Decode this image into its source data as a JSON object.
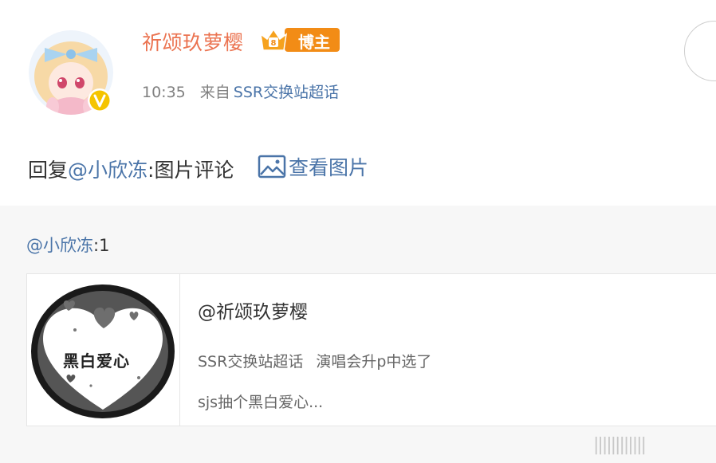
{
  "post": {
    "username": "祈颂玖萝樱",
    "badge_label": "博主",
    "time": "10:35",
    "from_label": "来自",
    "source": "SSR交换站超话",
    "reply_prefix": "回复",
    "reply_mention": "@小欣冻",
    "reply_suffix": ":图片评论",
    "view_pic_label": "查看图片"
  },
  "repost": {
    "mention": "@小欣冻",
    "text": ":1",
    "card": {
      "title": "@祈颂玖萝樱",
      "line1_a": "SSR交换站超话",
      "line1_b": "演唱会升p中选了",
      "line2": "sjs抽个黑白爱心...",
      "thumb_text": "黑白爱心"
    }
  },
  "watermark": "||||||||||||",
  "colors": {
    "username": "#eb7350",
    "link": "#4a74a8",
    "badge_bg": "#f28c16",
    "verified": "#f5c400",
    "repost_bg": "#f7f7f7"
  },
  "icons": {
    "avatar": "anime-girl-avatar",
    "verified": "verified-v-icon",
    "badge": "crown-icon",
    "view_pic": "picture-icon"
  }
}
